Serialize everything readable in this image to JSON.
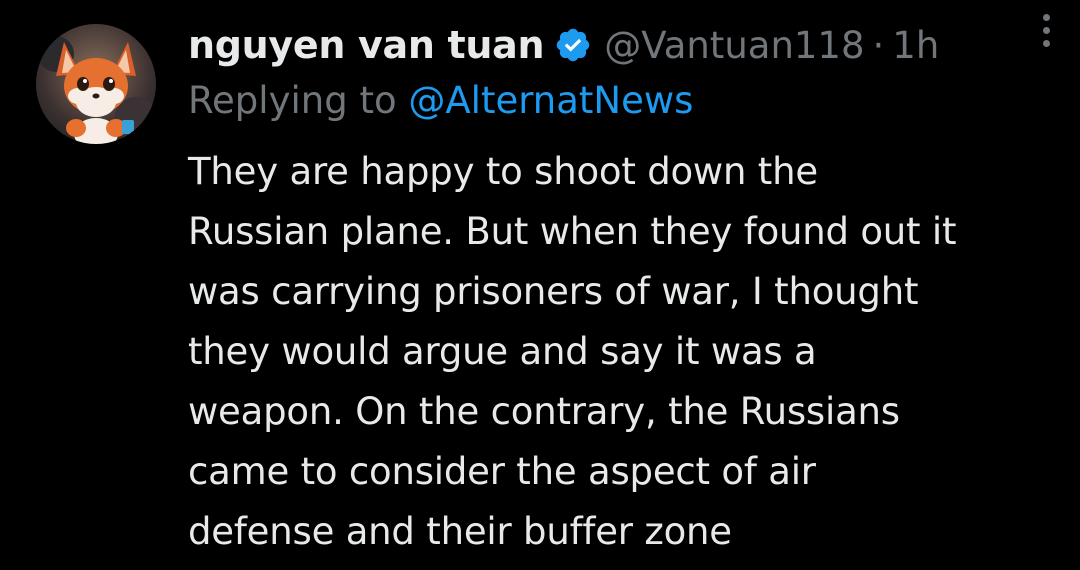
{
  "tweet": {
    "display_name": "nguyen van tuan",
    "verified_icon": "verified-badge-icon",
    "handle": "@Vantuan118",
    "separator": "·",
    "time": "1h",
    "reply_prefix": "Replying to",
    "reply_to": "@AlternatNews",
    "text_lines": [
      "They are happy to shoot down the",
      "Russian plane. But when they found out it",
      "was carrying prisoners of war, I thought",
      "they would argue and say it was a",
      "weapon. On the contrary, the Russians",
      "came to consider the aspect of air",
      "defense and their buffer zone"
    ],
    "more_icon": "more-options-icon",
    "avatar_icon": "fox-avatar-icon"
  },
  "colors": {
    "background": "#000000",
    "primary_text": "#e7e9ea",
    "secondary_text": "#71767b",
    "accent": "#1d9bf0"
  }
}
